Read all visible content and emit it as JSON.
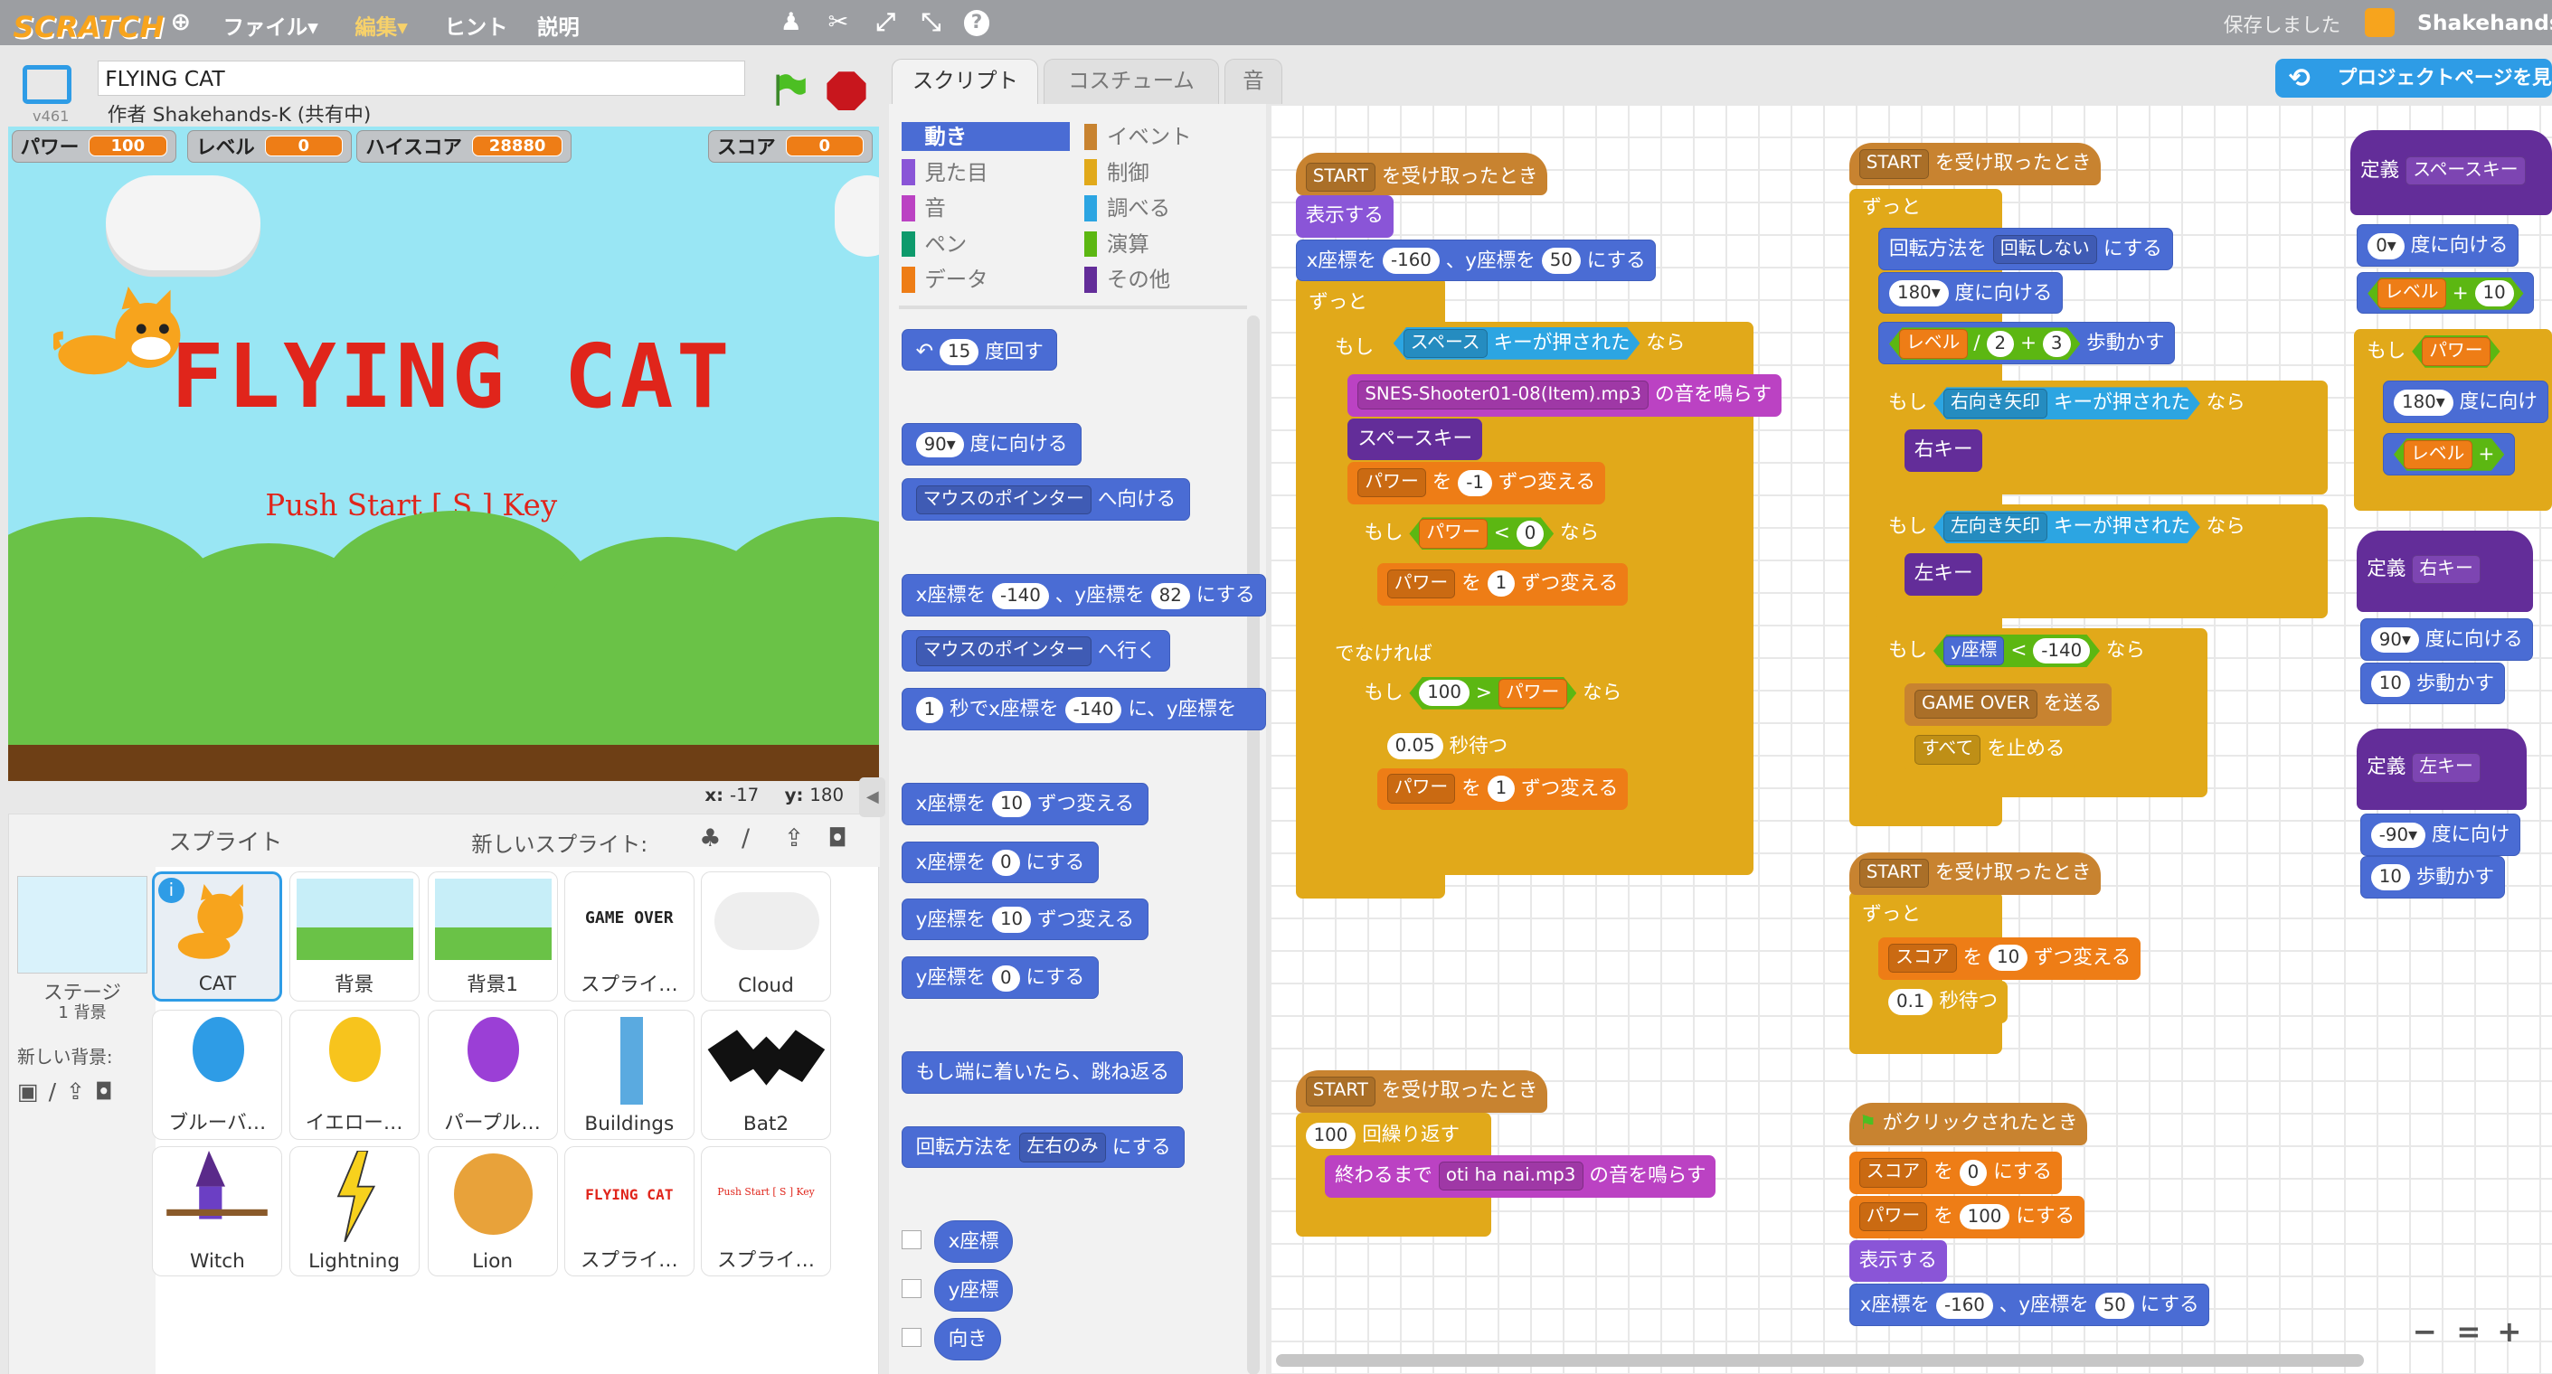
{
  "menu": {
    "logo": "SCRATCH",
    "file": "ファイル▾",
    "edit": "編集▾",
    "tips": "ヒント",
    "about": "説明",
    "saved": "保存しました",
    "user": "Shakehands-"
  },
  "project": {
    "title": "FLYING CAT",
    "author": "作者 Shakehands-K (共有中)",
    "version": "v461",
    "share_button": "プロジェクトページを見る"
  },
  "monitors": [
    {
      "label": "パワー",
      "value": "100"
    },
    {
      "label": "レベル",
      "value": "0"
    },
    {
      "label": "ハイスコア",
      "value": "28880"
    },
    {
      "label": "スコア",
      "value": "0"
    }
  ],
  "stage": {
    "title_text": "FLYING CAT",
    "subtitle_text": "Push Start [ S ] Key",
    "x_label": "x:",
    "x_value": "-17",
    "y_label": "y:",
    "y_value": "180"
  },
  "sprites": {
    "header": "スプライト",
    "new_sprite": "新しいスプライト:",
    "stage_label": "ステージ",
    "stage_sub": "1 背景",
    "new_backdrop": "新しい背景:",
    "items": [
      "CAT",
      "背景",
      "背景1",
      "スプライ…",
      "Cloud",
      "ブルーバ…",
      "イエロー…",
      "パープル…",
      "Buildings",
      "Bat2",
      "Witch",
      "Lightning",
      "Lion",
      "スプライ…",
      "スプライ…"
    ],
    "game_over_text": "GAME OVER",
    "flying_cat_text": "FLYING CAT",
    "push_text": "Push Start [ S ] Key"
  },
  "tabs": [
    "スクリプト",
    "コスチューム",
    "音"
  ],
  "categories": [
    {
      "label": "動き",
      "color": "#4a6cd4"
    },
    {
      "label": "イベント",
      "color": "#c88330"
    },
    {
      "label": "見た目",
      "color": "#8a55d7"
    },
    {
      "label": "制御",
      "color": "#e1a91a"
    },
    {
      "label": "音",
      "color": "#bb42c3"
    },
    {
      "label": "調べる",
      "color": "#2ca5e2"
    },
    {
      "label": "ペン",
      "color": "#0e9a6c"
    },
    {
      "label": "演算",
      "color": "#5cb712"
    },
    {
      "label": "データ",
      "color": "#ee7d16"
    },
    {
      "label": "その他",
      "color": "#632d99"
    }
  ],
  "palette": {
    "turn": "度回す",
    "turn_val": "15",
    "point_dir": "度に向ける",
    "point_dir_val": "90▾",
    "point_towards": "マウスのポインター",
    "point_towards_suffix": "へ向ける",
    "goto_xy_a": "x座標を",
    "goto_xy_x": "-140",
    "goto_xy_b": "、y座標を",
    "goto_xy_y": "82",
    "goto_xy_c": "にする",
    "goto": "マウスのポインター",
    "goto_suffix": "へ行く",
    "glide_a": "1",
    "glide_b": "秒でx座標を",
    "glide_x": "-140",
    "glide_c": "に、y座標を",
    "change_x": "x座標を",
    "change_x_val": "10",
    "change_suffix": "ずつ変える",
    "set_x": "x座標を",
    "set_val": "0",
    "set_suffix": "にする",
    "change_y": "y座標を",
    "change_y_val": "10",
    "set_y": "y座標を",
    "bounce": "もし端に着いたら、跳ね返る",
    "rotation_a": "回転方法を",
    "rotation_b": "左右のみ",
    "rotation_c": "にする",
    "rep_x": "x座標",
    "rep_y": "y座標",
    "rep_dir": "向き"
  },
  "script1": {
    "hat_msg": "START",
    "hat_suffix": "を受け取ったとき",
    "show": "表示する",
    "goto_a": "x座標を",
    "goto_x": "-160",
    "goto_b": "、y座標を",
    "goto_y": "50",
    "goto_c": "にする",
    "forever": "ずっと",
    "if": "もし",
    "key": "スペース",
    "key_suffix": "キーが押された",
    "then": "なら",
    "sound": "SNES-Shooter01-08(Item).mp3",
    "sound_suffix": "の音を鳴らす",
    "space_key": "スペースキー",
    "power": "パワー",
    "wo": "を",
    "neg1": "-1",
    "change_by": "ずつ変える",
    "lt": "<",
    "zero": "0",
    "one": "1",
    "else": "でなければ",
    "hundred": "100",
    "gt": ">",
    "wait": "0.05",
    "wait_suffix": "秒待つ"
  },
  "script2": {
    "hat_msg": "START",
    "hat_suffix": "を受け取ったとき",
    "forever": "ずっと",
    "rot_a": "回転方法を",
    "rot_b": "回転しない",
    "rot_c": "にする",
    "dir": "180▾",
    "dir_suffix": "度に向ける",
    "level": "レベル",
    "div": "/",
    "two": "2",
    "plus": "+",
    "three": "3",
    "move": "歩動かす",
    "if": "もし",
    "right_key": "右向き矢印",
    "key_pressed": "キーが押された",
    "then": "なら",
    "right": "右キー",
    "left_key": "左向き矢印",
    "left": "左キー",
    "ycoord": "y座標",
    "lt": "<",
    "neg140": "-140",
    "gameover": "GAME OVER",
    "broadcast": "を送る",
    "all": "すべて",
    "stop": "を止める"
  },
  "script3": {
    "hat_msg": "START",
    "hat_suffix": "を受け取ったとき",
    "forever": "ずっと",
    "score": "スコア",
    "wo": "を",
    "ten": "10",
    "change": "ずつ変える",
    "wait": "0.1",
    "wait_suffix": "秒待つ"
  },
  "script4": {
    "hat_msg": "START",
    "hat_suffix": "を受け取ったとき",
    "repeat_val": "100",
    "repeat": "回繰り返す",
    "until": "終わるまで",
    "sound": "oti ha nai.mp3",
    "sound_suffix": "の音を鳴らす"
  },
  "script5": {
    "hat": "がクリックされたとき",
    "score": "スコア",
    "wo": "を",
    "zero": "0",
    "set": "にする",
    "power": "パワー",
    "hundred": "100",
    "show": "表示する",
    "goto_a": "x座標を",
    "goto_x": "-160",
    "goto_b": "、y座標を",
    "goto_y": "50",
    "goto_c": "にする"
  },
  "script6": {
    "define": "定義",
    "name": "スペースキー",
    "dir": "0▾",
    "dir_suffix": "度に向ける",
    "level": "レベル",
    "plus": "+",
    "ten": "10",
    "if": "もし",
    "power": "パワー",
    "dir180": "180▾",
    "dir180_suffix": "度に向け"
  },
  "script7": {
    "define": "定義",
    "name": "右キー",
    "dir": "90▾",
    "dir_suffix": "度に向ける",
    "steps": "10",
    "move": "歩動かす"
  },
  "script8": {
    "define": "定義",
    "name": "左キー",
    "dir": "-90▾",
    "dir_suffix": "度に向け",
    "steps": "10",
    "move": "歩動かす"
  },
  "zoom": {
    "out": "−",
    "reset": "=",
    "in": "+"
  }
}
